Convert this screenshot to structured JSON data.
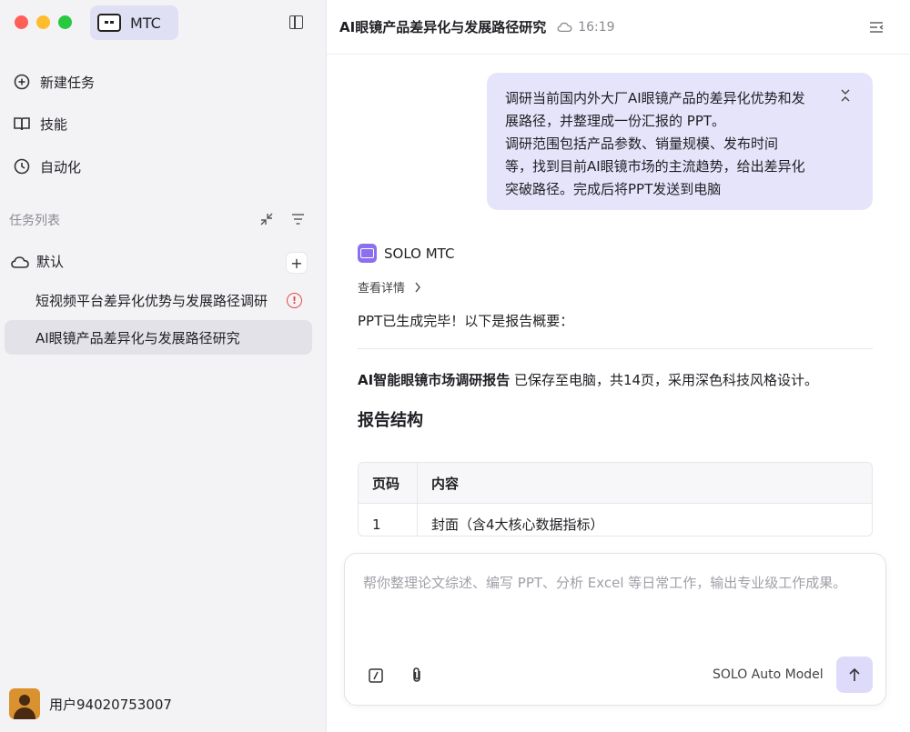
{
  "app": {
    "name": "MTC",
    "traffic_lights": {
      "close": "#fe5f57",
      "minimize": "#febc2e",
      "maximize": "#28c840"
    }
  },
  "sidebar": {
    "nav": [
      {
        "label": "新建任务",
        "icon": "new-task-icon"
      },
      {
        "label": "技能",
        "icon": "book-icon"
      },
      {
        "label": "自动化",
        "icon": "clock-icon"
      }
    ],
    "section_title": "任务列表",
    "group": {
      "label": "默认",
      "icon": "cloud-icon",
      "add_label": "+"
    },
    "tasks": [
      {
        "label": "短视频平台差异化优势与发展路径调研",
        "status_icon": "alert-icon",
        "alert_mark": "!"
      },
      {
        "label": "AI眼镜产品差异化与发展路径研究",
        "selected": true
      }
    ],
    "user": {
      "name": "用户94020753007"
    }
  },
  "header": {
    "title": "AI眼镜产品差异化与发展路径研究",
    "time": "16:19"
  },
  "conversation": {
    "user_message_lines": [
      "调研当前国内外大厂AI眼镜产品的差异化优势和发",
      "展路径，并整理成一份汇报的 PPT。",
      "调研范围包括产品参数、销量规模、发布时间",
      "等，找到目前AI眼镜市场的主流趋势，给出差异化",
      "突破路径。完成后将PPT发送到电脑"
    ],
    "bot_name": "SOLO MTC",
    "details_label": "查看详情",
    "reply_intro": "PPT已生成完毕！以下是报告概要：",
    "report_title": "AI智能眼镜市场调研报告",
    "report_summary": " 已保存至电脑，共14页，采用深色科技风格设计。",
    "section_heading": "报告结构",
    "table": {
      "headers": [
        "页码",
        "内容"
      ],
      "rows": [
        [
          "1",
          "封面（含4大核心数据指标）"
        ]
      ]
    }
  },
  "composer": {
    "placeholder": "帮你整理论文综述、编写 PPT、分析 Excel 等日常工作，输出专业级工作成果。",
    "model": "SOLO Auto Model",
    "accent": "#dedbfa"
  }
}
